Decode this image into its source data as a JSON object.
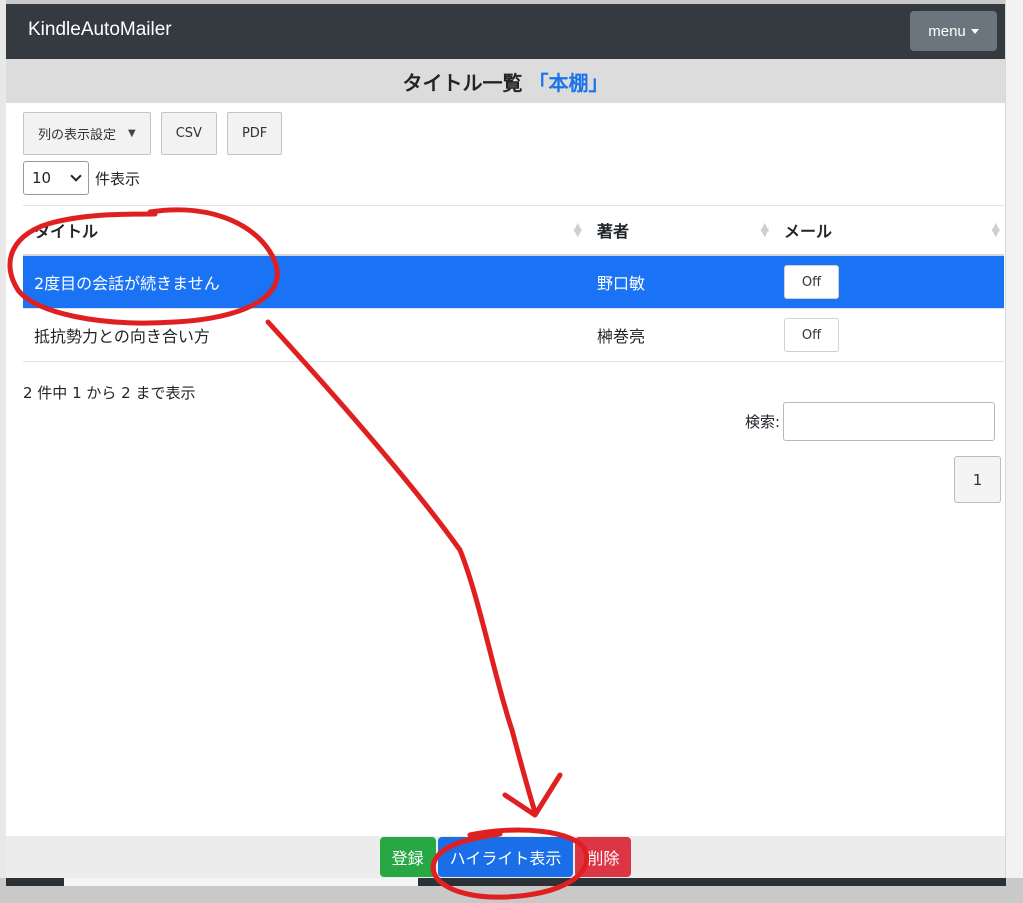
{
  "app": {
    "title": "KindleAutoMailer",
    "menu_label": "menu"
  },
  "page": {
    "heading": "タイトル一覧",
    "shelf": "「本棚」"
  },
  "toolbar": {
    "columns_label": "列の表示設定",
    "columns_tri": "▼",
    "csv_label": "CSV",
    "pdf_label": "PDF"
  },
  "length": {
    "value": "10",
    "suffix": "件表示"
  },
  "table": {
    "headers": [
      "タイトル",
      "著者",
      "メール"
    ],
    "rows": [
      {
        "title": "2度目の会話が続きません",
        "author": "野口敏",
        "mail": "Off",
        "selected": true
      },
      {
        "title": "抵抗勢力との向き合い方",
        "author": "榊巻亮",
        "mail": "Off",
        "selected": false
      }
    ]
  },
  "info": "2 件中 1 から 2 まで表示",
  "search": {
    "label": "検索:",
    "value": ""
  },
  "pagination": {
    "page": "1"
  },
  "footer": {
    "register_label": "登録",
    "highlight_label": "ハイライト表示",
    "delete_label": "削除"
  },
  "colors": {
    "navbar": "#343a40",
    "selected_row": "#1a73f5",
    "register": "#28a745",
    "highlight": "#1a6ee8",
    "delete": "#dc3545",
    "annotation": "#e02020"
  }
}
